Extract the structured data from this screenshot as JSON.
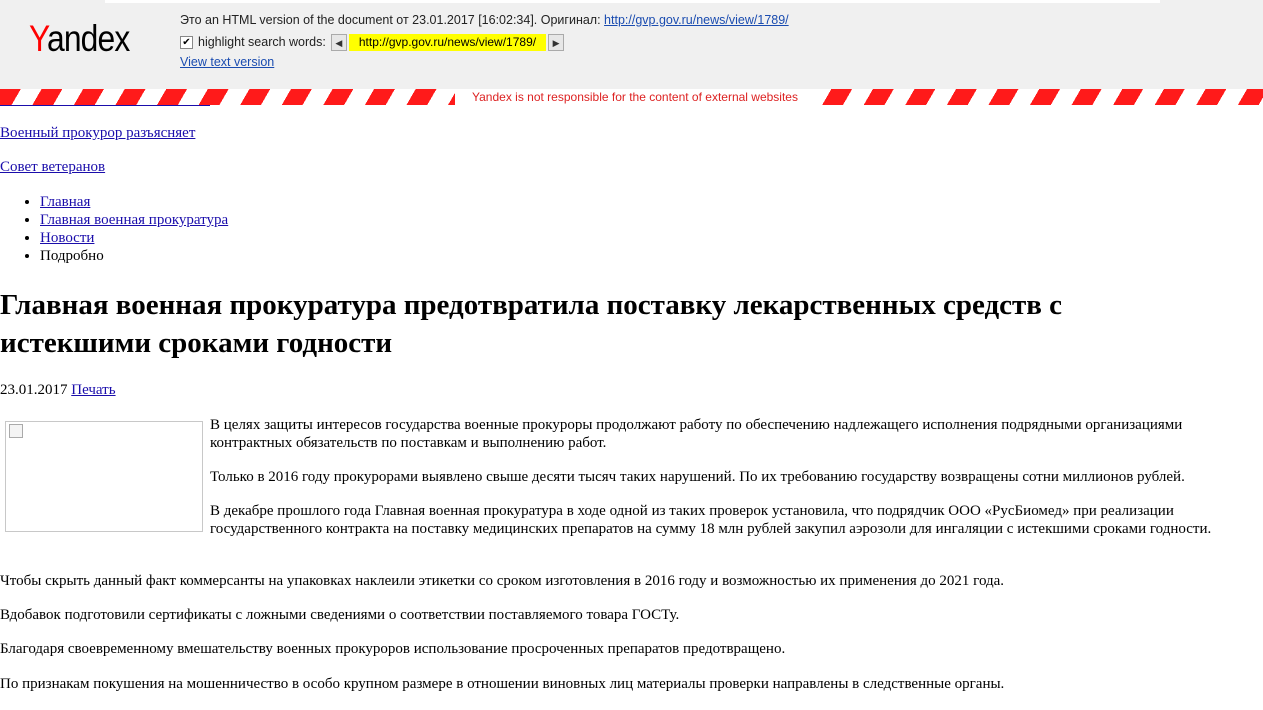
{
  "yandex_header": {
    "logo_text": "andex",
    "logo_first": "Y",
    "notice": "Это an HTML version of the document от 23.01.2017 [16:02:34]. Оригинал: ",
    "original_url": "http://gvp.gov.ru/news/view/1789/",
    "highlight_label": "highlight search words:",
    "highlight_word": "http://gvp.gov.ru/news/view/1789/",
    "view_text": "View text version",
    "disclaimer": "Yandex is not responsible for the content of external websites"
  },
  "links": {
    "military_prosecutor": "Военный прокурор разъясняет",
    "veterans_council": "Совет ветеранов"
  },
  "breadcrumbs": [
    {
      "label": "Главная"
    },
    {
      "label": "Главная военная прокуратура"
    },
    {
      "label": "Новости"
    },
    {
      "label": "Подробно"
    }
  ],
  "article": {
    "title": "Главная военная прокуратура предотвратила поставку лекарственных средств с истекшими сроками годности",
    "date": "23.01.2017",
    "print_label": "Печать",
    "paragraphs": [
      "В целях защиты интересов государства военные прокуроры продолжают работу по обеспечению надлежащего исполнения  подрядными организациями контрактных обязательств по поставкам и выполнению работ.",
      "Только в 2016 году прокурорами выявлено свыше десяти тысяч таких нарушений. По их требованию государству возвращены сотни миллионов рублей.",
      "В декабре прошлого года Главная военная прокуратура в ходе одной из таких проверок установила, что подрядчик ООО «РусБиомед» при реализации государственного контракта на поставку медицинских препаратов на сумму 18 млн рублей закупил аэрозоли для ингаляции с истекшими сроками годности.",
      "Чтобы скрыть данный факт коммерсанты на упаковках наклеили этикетки со сроком изготовления в 2016 году и возможностью их применения до 2021 года.",
      "Вдобавок подготовили сертификаты с ложными сведениями о соответствии поставляемого товара ГОСТу.",
      "Благодаря своевременному вмешательству военных прокуроров использование просроченных препаратов предотвращено.",
      "По признакам покушения на мошенничество в особо крупном размере в отношении виновных лиц материалы проверки направлены в следственные органы."
    ]
  }
}
